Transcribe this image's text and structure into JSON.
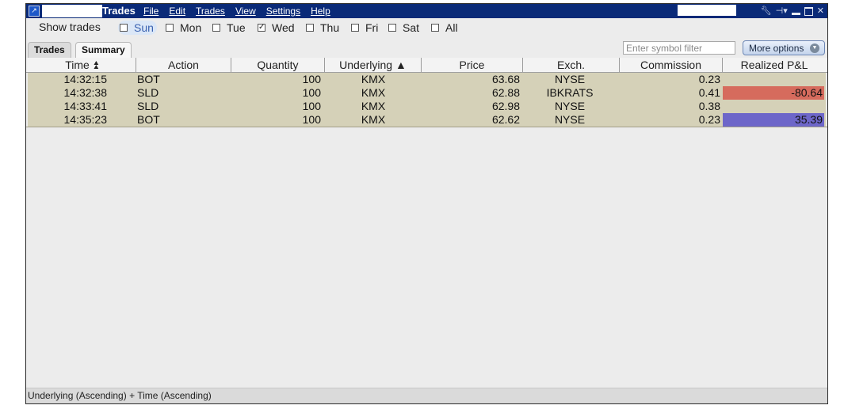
{
  "window": {
    "title": "Trades",
    "menu": [
      "File",
      "Edit",
      "Trades",
      "View",
      "Settings",
      "Help"
    ]
  },
  "days": {
    "label": "Show trades",
    "items": [
      {
        "label": "Sun",
        "checked": false,
        "selected": true
      },
      {
        "label": "Mon",
        "checked": false
      },
      {
        "label": "Tue",
        "checked": false
      },
      {
        "label": "Wed",
        "checked": true
      },
      {
        "label": "Thu",
        "checked": false
      },
      {
        "label": "Fri",
        "checked": false
      },
      {
        "label": "Sat",
        "checked": false
      },
      {
        "label": "All",
        "checked": false
      }
    ]
  },
  "tabs": [
    {
      "label": "Trades"
    },
    {
      "label": "Summary",
      "active": true
    }
  ],
  "filter": {
    "placeholder": "Enter symbol filter"
  },
  "more_options": {
    "label": "More options"
  },
  "columns": {
    "time": "Time",
    "action": "Action",
    "quantity": "Quantity",
    "underlying": "Underlying",
    "price": "Price",
    "exch": "Exch.",
    "commission": "Commission",
    "pnl": "Realized P&L"
  },
  "rows": [
    {
      "time": "14:32:15",
      "action": "BOT",
      "quantity": "100",
      "underlying": "KMX",
      "price": "63.68",
      "exch": "NYSE",
      "commission": "0.23",
      "pnl": ""
    },
    {
      "time": "14:32:38",
      "action": "SLD",
      "quantity": "100",
      "underlying": "KMX",
      "price": "62.88",
      "exch": "IBKRATS",
      "commission": "0.41",
      "pnl": "-80.64"
    },
    {
      "time": "14:33:41",
      "action": "SLD",
      "quantity": "100",
      "underlying": "KMX",
      "price": "62.98",
      "exch": "NYSE",
      "commission": "0.38",
      "pnl": ""
    },
    {
      "time": "14:35:23",
      "action": "BOT",
      "quantity": "100",
      "underlying": "KMX",
      "price": "62.62",
      "exch": "NYSE",
      "commission": "0.23",
      "pnl": "35.39"
    }
  ],
  "colors": {
    "titlebar": "#0a2a78",
    "row_bg": "#d5d1b8",
    "loss": "#d66b5d",
    "gain": "#6d66c9"
  },
  "status": {
    "text": "Underlying (Ascending)  +  Time (Ascending)"
  }
}
